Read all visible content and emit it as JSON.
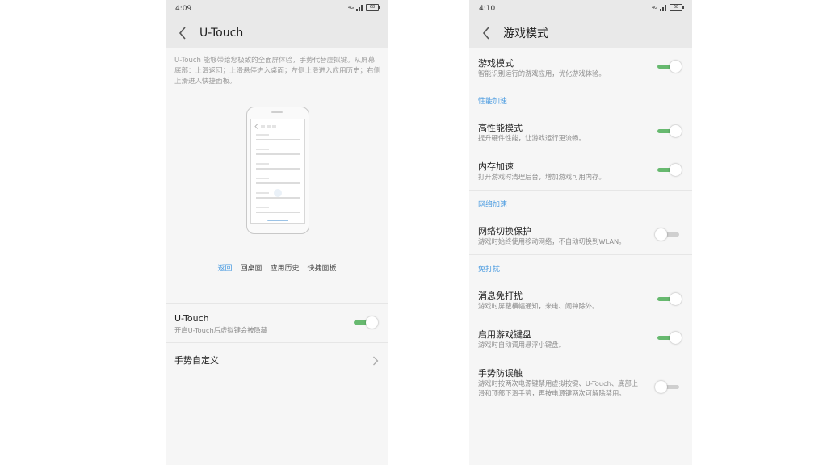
{
  "left": {
    "status": {
      "time": "4:09",
      "signal": "4G",
      "battery": "68"
    },
    "header": {
      "title": "U-Touch"
    },
    "intro": "U-Touch 能够带给您极致的全面屏体验，手势代替虚拟键。从屏幕底部：上滑返回；上滑悬停进入桌面；左侧上滑进入应用历史；右侧上滑进入快捷面板。",
    "gesture_tabs": [
      {
        "label": "返回",
        "active": true
      },
      {
        "label": "回桌面",
        "active": false
      },
      {
        "label": "应用历史",
        "active": false
      },
      {
        "label": "快捷面板",
        "active": false
      }
    ],
    "utouch": {
      "label": "U-Touch",
      "desc": "开启U-Touch后虚拟键会被隐藏",
      "on": true
    },
    "custom": {
      "label": "手势自定义"
    }
  },
  "right": {
    "status": {
      "time": "4:10",
      "signal": "4G",
      "battery": "68"
    },
    "header": {
      "title": "游戏模式"
    },
    "game_mode": {
      "label": "游戏模式",
      "desc": "智能识别运行的游戏应用，优化游戏体验。",
      "on": true
    },
    "sections": {
      "perf": "性能加速",
      "net": "网络加速",
      "dnd": "免打扰"
    },
    "high_perf": {
      "label": "高性能模式",
      "desc": "提升硬件性能，让游戏运行更流畅。",
      "on": true
    },
    "memory": {
      "label": "内存加速",
      "desc": "打开游戏时清理后台，增加游戏可用内存。",
      "on": true
    },
    "net_protect": {
      "label": "网络切换保护",
      "desc": "游戏时始终使用移动网络，不自动切换到WLAN。",
      "on": false
    },
    "msg_dnd": {
      "label": "消息免打扰",
      "desc": "游戏时屏蔽横幅通知，来电、闹钟除外。",
      "on": true
    },
    "game_keyboard": {
      "label": "启用游戏键盘",
      "desc": "游戏时自动调用悬浮小键盘。",
      "on": true
    },
    "gesture_guard": {
      "label": "手势防误触",
      "desc": "游戏时按两次电源键禁用虚拟按键、U-Touch、底部上滑和顶部下滑手势，再按电源键两次可解除禁用。",
      "on": false
    }
  },
  "colors": {
    "accent": "#4a9be0",
    "switch_on": "#67b96f",
    "switch_off": "#cfcfcf"
  }
}
